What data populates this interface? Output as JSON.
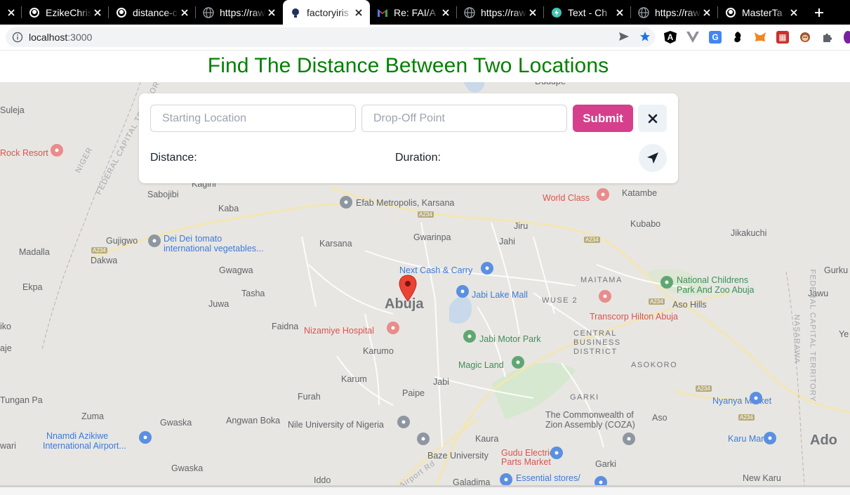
{
  "browser": {
    "tabs": [
      {
        "title": "",
        "icon": "close-icon",
        "active": false
      },
      {
        "title": "EzikeChris",
        "icon": "github-icon",
        "active": false
      },
      {
        "title": "distance-c",
        "icon": "github-icon",
        "active": false
      },
      {
        "title": "https://raw",
        "icon": "globe-icon",
        "active": false
      },
      {
        "title": "factoryiris",
        "icon": "app-icon",
        "active": true
      },
      {
        "title": "Re: FAI/A",
        "icon": "gmail-icon",
        "active": false
      },
      {
        "title": "https://raw",
        "icon": "globe-icon",
        "active": false
      },
      {
        "title": "Text - Ch",
        "icon": "bolt-icon",
        "active": false
      },
      {
        "title": "https://raw",
        "icon": "globe-icon",
        "active": false
      },
      {
        "title": "MasterTa",
        "icon": "github-icon",
        "active": false
      }
    ],
    "url_host": "localhost",
    "url_port": ":3000"
  },
  "page": {
    "title": "Find The Distance Between Two Locations"
  },
  "form": {
    "start_placeholder": "Starting Location",
    "dropoff_placeholder": "Drop-Off Point",
    "submit_label": "Submit",
    "distance_label": "Distance:",
    "duration_label": "Duration:"
  },
  "map": {
    "city": "Abuja",
    "labels": {
      "suleja": "Suleja",
      "rock_resort": "Rock Resort",
      "dudupe": "Dudupe",
      "kagini": "Kagini",
      "kaba": "Kaba",
      "sabojibi": "Sabojibi",
      "efab": "Efab Metropolis, Karsana",
      "world_class": "World Class",
      "katambe": "Katambe",
      "kubabo": "Kubabo",
      "jikakuchi": "Jikakuchi",
      "jiru": "Jiru",
      "gujigwo": "Gujigwo",
      "dei_dei_1": "Dei Dei",
      "dei_dei_2": "tomato",
      "dei_dei_3": "international vegetables...",
      "madalla": "Madalla",
      "dakwa": "Dakwa",
      "karsana": "Karsana",
      "gwarinpa": "Gwarinpa",
      "jahi": "Jahi",
      "gurku": "Gurku",
      "gwagwa": "Gwagwa",
      "next_cash": "Next Cash & Carry",
      "maitama": "MAITAMA",
      "national_childrens_1": "National Childrens",
      "national_childrens_2": "Park And Zoo Abuja",
      "jawu": "Jawu",
      "ekpa": "Ekpa",
      "tasha": "Tasha",
      "jabi_lake": "Jabi Lake Mall",
      "wuse2": "WUSE 2",
      "aso_hills": "Aso Hills",
      "juwa": "Juwa",
      "transcorp": "Transcorp Hilton Abuja",
      "ye": "Ye",
      "kiko": "iko",
      "faidna": "Faidna",
      "nizamiye": "Nizamiye Hospital",
      "jabi_motor": "Jabi Motor Park",
      "cbd_1": "CENTRAL",
      "cbd_2": "BUSINESS",
      "cbd_3": "DISTRICT",
      "aje": "aje",
      "karumo": "Karumo",
      "magic_land": "Magic Land",
      "asokoro": "ASOKORO",
      "karum": "Karum",
      "jabi": "Jabi",
      "tungan_pa": "Tungan Pa",
      "furah": "Furah",
      "paipe": "Paipe",
      "garki": "GARKI",
      "nyanya": "Nyanya Market",
      "zuma": "Zuma",
      "gwaska": "Gwaska",
      "angwan_boka": "Angwan Boka",
      "nile": "Nile University of Nigeria",
      "commonwealth_1": "The Commonwealth of",
      "commonwealth_2": "Zion Assembly (COZA)",
      "aso": "Aso",
      "nnamdi_1": "Nnamdi Azikiwe",
      "nnamdi_2": "International Airport...",
      "kaura": "Kaura",
      "karu": "Karu Market",
      "ado": "Ado",
      "wari": "wari",
      "baze": "Baze University",
      "gudu_1": "Gudu Electrical",
      "gudu_2": "Parts Market",
      "gwaska2": "Gwaska",
      "garki2": "Garki",
      "iddo": "Iddo",
      "galadima": "Galadima",
      "essential": "Essential stores/",
      "new_karu": "New Karu",
      "airport_rd": "Airport Rd",
      "a234_1": "A234",
      "a234_2": "A234",
      "a234_3": "A234",
      "a234_4": "A234",
      "a234_5": "A234",
      "a234_6": "A234",
      "fct_1": "FEDERAL CAPITAL TERRITORY",
      "niger": "NIGER",
      "fct_2": "FEDERAL CAPITAL TERRITORY",
      "nasarawa": "NASARAWA"
    }
  },
  "colors": {
    "title_green": "#008000",
    "submit_pink": "#d53f8c",
    "map_bg": "#e8e6e2",
    "marker_red": "#ea4335"
  }
}
